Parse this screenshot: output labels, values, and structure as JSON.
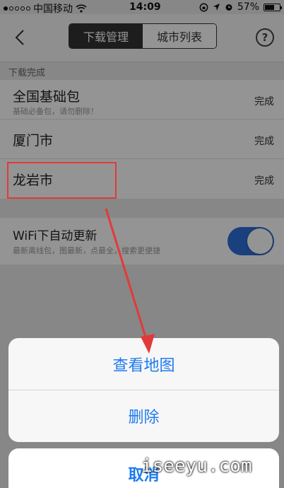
{
  "status_bar": {
    "carrier": "中国移动",
    "time": "14:09",
    "battery": "57%",
    "battery_level": 0.57
  },
  "header": {
    "tabs": [
      {
        "label": "下载管理",
        "active": true
      },
      {
        "label": "城市列表",
        "active": false
      }
    ],
    "help_label": "?"
  },
  "section_title": "下载完成",
  "downloads": [
    {
      "name": "全国基础包",
      "sub": "基础必备包，请勿删除！",
      "status": "完成"
    },
    {
      "name": "厦门市",
      "sub": "",
      "status": "完成"
    },
    {
      "name": "龙岩市",
      "sub": "",
      "status": "完成"
    }
  ],
  "wifi": {
    "title": "WiFi下自动更新",
    "subtitle": "最新离线包，图最新，点最全，搜索更便捷",
    "enabled": true
  },
  "action_sheet": {
    "options": [
      "查看地图",
      "删除"
    ],
    "cancel": "取消"
  },
  "watermark": "iseeyu.com",
  "colors": {
    "accent": "#1e7bf0",
    "toggle_on": "#2e6fd9",
    "highlight": "#e23a3a"
  }
}
